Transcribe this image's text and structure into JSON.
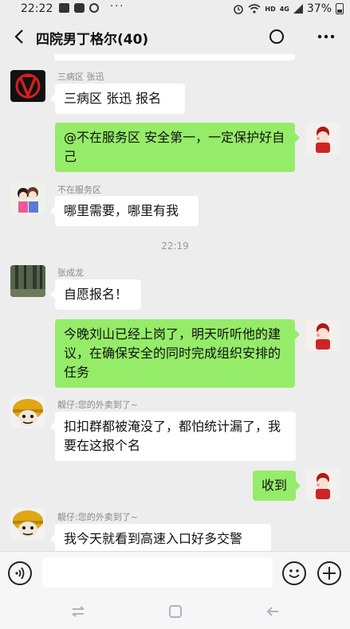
{
  "status_bar": {
    "time": "22:22",
    "more": "···",
    "network_hd": "HD",
    "network_4g": "4G",
    "battery": "37%"
  },
  "header": {
    "title": "四院男丁格尔(40)"
  },
  "messages": [
    {
      "side": "left",
      "sender": "三病区 张迅",
      "text": "三病区  张迅  报名",
      "avatar": "v-logo-avatar"
    },
    {
      "side": "right",
      "text": "@不在服务区  安全第一，一定保护好自己",
      "avatar": "self-cartoon-avatar"
    },
    {
      "side": "left",
      "sender": "不在服务区",
      "text": "哪里需要，哪里有我",
      "avatar": "couple-cartoon-avatar"
    },
    {
      "type": "timestamp",
      "text": "22:19"
    },
    {
      "side": "left",
      "sender": "张成龙",
      "text": "自愿报名！",
      "avatar": "forest-photo-avatar"
    },
    {
      "side": "right",
      "text": "今晚刘山已经上岗了，明天听听他的建议，在确保安全的同时完成组织安排的任务",
      "avatar": "self-cartoon-avatar"
    },
    {
      "side": "left",
      "sender": "靓仔:您的外卖到了~",
      "text": "扣扣群都被淹没了，都怕统计漏了，我要在这报个名",
      "avatar": "helmet-meme-avatar"
    },
    {
      "side": "right",
      "text": "收到",
      "avatar": "self-cartoon-avatar"
    },
    {
      "side": "left",
      "sender": "靓仔:您的外卖到了~",
      "text": "我今天就看到高速入口好多交警",
      "avatar": "helmet-meme-avatar"
    }
  ],
  "input_bar": {
    "placeholder": ""
  },
  "colors": {
    "background": "#ededed",
    "bubble_self": "#95ec69",
    "bubble_other": "#ffffff"
  }
}
